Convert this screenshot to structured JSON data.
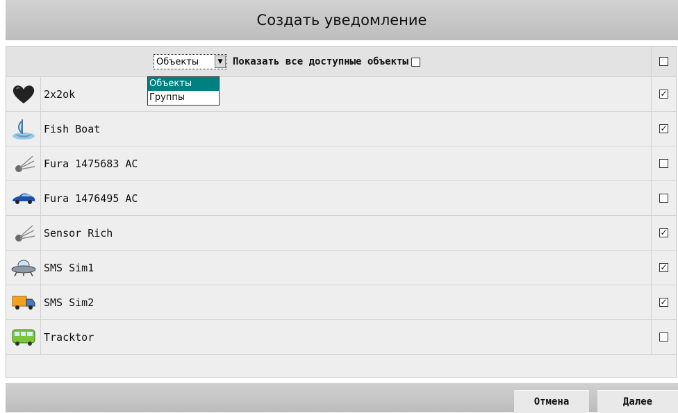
{
  "title": "Создать уведомление",
  "header": {
    "select_value": "Объекты",
    "show_all_label": "Показать все доступные объекты",
    "show_all_checked": false,
    "select_all_checked": false
  },
  "dropdown": {
    "options": [
      "Объекты",
      "Группы"
    ],
    "selected_index": 0
  },
  "objects": [
    {
      "name": "2x2ok",
      "icon": "heart-icon",
      "checked": true
    },
    {
      "name": "Fish Boat",
      "icon": "boat-icon",
      "checked": true
    },
    {
      "name": "Fura 1475683 AC",
      "icon": "satellite-icon",
      "checked": false
    },
    {
      "name": "Fura 1476495 AC",
      "icon": "car-icon",
      "checked": false
    },
    {
      "name": "Sensor Rich",
      "icon": "satellite-icon",
      "checked": true
    },
    {
      "name": "SMS Sim1",
      "icon": "ufo-icon",
      "checked": true
    },
    {
      "name": "SMS Sim2",
      "icon": "truck-icon",
      "checked": true
    },
    {
      "name": "Tracktor",
      "icon": "bus-icon",
      "checked": false
    }
  ],
  "buttons": {
    "cancel": "Отмена",
    "next": "Далее"
  }
}
